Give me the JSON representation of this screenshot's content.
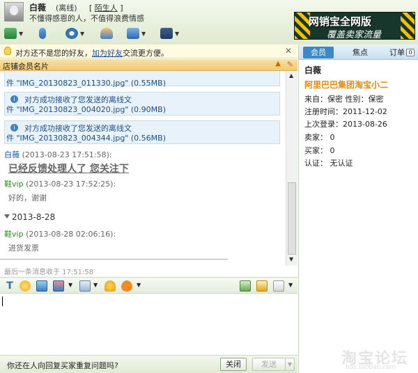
{
  "header": {
    "contact_name": "白薇",
    "status": "(离线)",
    "relation_text": "陌生人",
    "signature": "不懂得感恩的人，不值得浪费情感"
  },
  "banner": {
    "line1": "网销宝全网版",
    "line2": "覆盖卖家流量"
  },
  "tip": {
    "text1": "对方还不是您的好友，",
    "link": "加为好友",
    "text2": "交流更方便。"
  },
  "section": {
    "title": "店铺会员名片"
  },
  "chat": {
    "system_messages": [
      {
        "line1": "",
        "line2": "件 \"IMG_20130823_011330.jpg\" (0.55MB)"
      },
      {
        "line1": "对方成功接收了您发送的离线文",
        "line2": "件 \"IMG_20130823_004020.jpg\" (0.90MB)"
      },
      {
        "line1": "对方成功接收了您发送的离线文",
        "line2": "件 \"IMG_20130823_004344.jpg\" (0.56MB)"
      }
    ],
    "messages": [
      {
        "sender": "白薇",
        "time": "(2013-08-23 17:51:58):",
        "text": "已经反馈处理人了 您关注下"
      },
      {
        "sender": "鞋vip",
        "time": "(2013-08-23 17:52:25):",
        "text": "好的，谢谢"
      },
      {
        "sender": "鞋vip",
        "time": "(2013-08-28 02:06:16):",
        "text": "进货发票"
      }
    ],
    "date_divider": "2013-8-28",
    "last_received": "最后一条消息收于 17:51:58"
  },
  "bottom": {
    "question": "你还在人向回复买家重复问题吗?",
    "close_label": "关闭",
    "send_label": "发送"
  },
  "sidebar": {
    "tabs": [
      "会员",
      "焦点",
      "订单"
    ],
    "order_count": "0",
    "name": "白薇",
    "shop": "阿里巴巴集团淘宝小二",
    "info": [
      "来自：保密   性别：保密",
      "注册时间：2011-12-02",
      "上次登录：2013-08-26",
      "卖家：  0",
      "买家：  0",
      "认证：  无认证"
    ]
  },
  "watermark": {
    "big": "淘宝论坛",
    "small": "bbs.taobao.com"
  },
  "colors": {
    "accent": "#3f88c6",
    "shop": "#e8890b",
    "link": "#1a4fa0"
  }
}
